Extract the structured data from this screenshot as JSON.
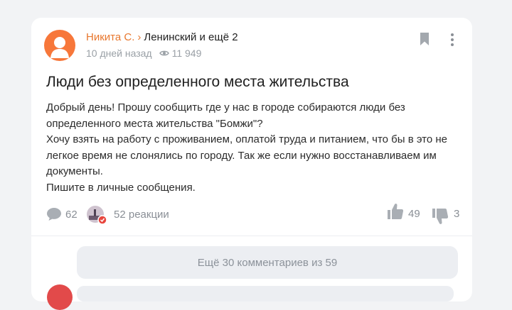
{
  "post": {
    "author": "Никита С.",
    "chevron": "›",
    "location": "Ленинский и ещё 2",
    "time": "10 дней назад",
    "views": "11 949",
    "title": "Люди без определенного места жительства",
    "body_lines": [
      "Добрый день! Прошу сообщить где у нас в городе собираются люди без",
      "определенного места жительства \"Бомжи\"?",
      "Хочу взять на работу с проживанием, оплатой труда и питанием, что бы в это не",
      "легкое время не слонялись по городу. Так же если нужно восстанавливаем им",
      "документы.",
      "Пишите в личные сообщения."
    ],
    "comments_count": "62",
    "reactions_label": "52 реакции",
    "likes": "49",
    "dislikes": "3"
  },
  "comments": {
    "show_more_label": "Ещё 30 комментариев из 59"
  },
  "colors": {
    "accent": "#e8772e",
    "avatar": "#f7773a",
    "icon_gray": "#9aa0a6"
  },
  "icons": {
    "bookmark": "bookmark-icon",
    "more": "more-vertical-icon",
    "views": "eye-icon",
    "comment": "comment-icon",
    "like": "thumbs-up-icon",
    "dislike": "thumbs-down-icon"
  }
}
